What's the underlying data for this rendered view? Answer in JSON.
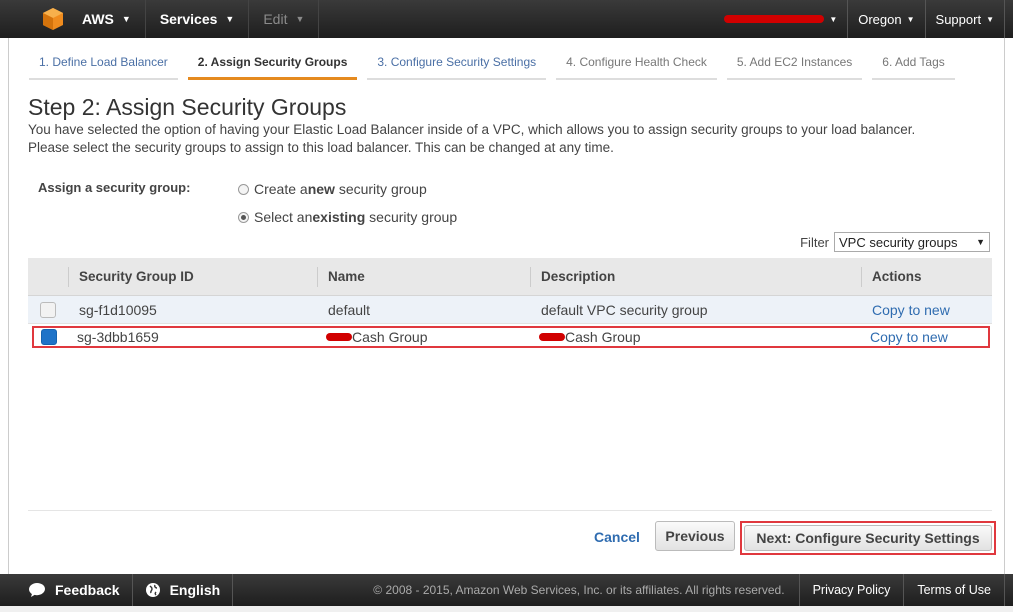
{
  "topnav": {
    "brand": "AWS",
    "services": "Services",
    "edit": "Edit",
    "region": "Oregon",
    "support": "Support"
  },
  "wizard": {
    "tabs": [
      {
        "label": "1. Define Load Balancer"
      },
      {
        "label": "2. Assign Security Groups"
      },
      {
        "label": "3. Configure Security Settings"
      },
      {
        "label": "4. Configure Health Check"
      },
      {
        "label": "5. Add EC2 Instances"
      },
      {
        "label": "6. Add Tags"
      }
    ],
    "active_tab": 1
  },
  "main": {
    "title": "Step 2: Assign Security Groups",
    "description_line1": "You have selected the option of having your Elastic Load Balancer inside of a VPC, which allows you to assign security groups to your load balancer.",
    "description_line2": "Please select the security groups to assign to this load balancer. This can be changed at any time.",
    "assign_label": "Assign a security group:",
    "radio_create_prefix": "Create a ",
    "radio_create_bold": "new",
    "radio_create_suffix": " security group",
    "radio_existing_prefix": "Select an ",
    "radio_existing_bold": "existing",
    "radio_existing_suffix": " security group",
    "selected_radio": "existing",
    "filter_label": "Filter",
    "filter_value": "VPC security groups"
  },
  "table": {
    "headers": {
      "id": "Security Group ID",
      "name": "Name",
      "description": "Description",
      "actions": "Actions"
    },
    "rows": [
      {
        "id": "sg-f1d10095",
        "name": "default",
        "description": "default VPC security group",
        "action": "Copy to new",
        "checked": false
      },
      {
        "id": "sg-3dbb1659",
        "name": "Cash Group",
        "description": "Cash Group",
        "action": "Copy to new",
        "checked": true
      }
    ]
  },
  "footer_buttons": {
    "cancel": "Cancel",
    "previous": "Previous",
    "next": "Next: Configure Security Settings"
  },
  "bottombar": {
    "feedback": "Feedback",
    "language": "English",
    "copyright": "© 2008 - 2015, Amazon Web Services, Inc. or its affiliates. All rights reserved.",
    "privacy": "Privacy Policy",
    "terms": "Terms of Use"
  },
  "colors": {
    "nav_bg": "#232323",
    "active_tab_accent": "#e58a1f",
    "link": "#2f6cb0",
    "highlight_outline": "#e0383e",
    "checkbox_checked": "#1e73c8"
  }
}
